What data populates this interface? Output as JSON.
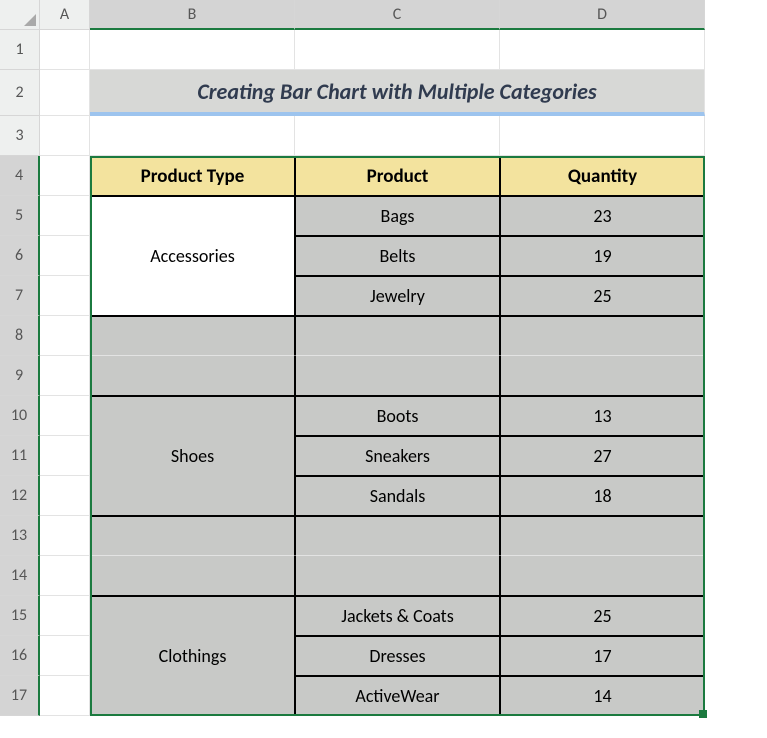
{
  "columns": [
    "A",
    "B",
    "C",
    "D"
  ],
  "rows": [
    "1",
    "2",
    "3",
    "4",
    "5",
    "6",
    "7",
    "8",
    "9",
    "10",
    "11",
    "12",
    "13",
    "14",
    "15",
    "16",
    "17"
  ],
  "title": "Creating Bar Chart with Multiple Categories",
  "headers": {
    "col_b": "Product Type",
    "col_c": "Product",
    "col_d": "Quantity"
  },
  "groups": [
    {
      "type": "Accessories",
      "items": [
        {
          "product": "Bags",
          "qty": "23"
        },
        {
          "product": "Belts",
          "qty": "19"
        },
        {
          "product": "Jewelry",
          "qty": "25"
        }
      ]
    },
    {
      "type": "Shoes",
      "items": [
        {
          "product": "Boots",
          "qty": "13"
        },
        {
          "product": "Sneakers",
          "qty": "27"
        },
        {
          "product": "Sandals",
          "qty": "18"
        }
      ]
    },
    {
      "type": "Clothings",
      "items": [
        {
          "product": "Jackets & Coats",
          "qty": "25"
        },
        {
          "product": "Dresses",
          "qty": "17"
        },
        {
          "product": "ActiveWear",
          "qty": "14"
        }
      ]
    }
  ],
  "chart_data": {
    "type": "table",
    "title": "Creating Bar Chart with Multiple Categories",
    "columns": [
      "Product Type",
      "Product",
      "Quantity"
    ],
    "rows": [
      [
        "Accessories",
        "Bags",
        23
      ],
      [
        "Accessories",
        "Belts",
        19
      ],
      [
        "Accessories",
        "Jewelry",
        25
      ],
      [
        "Shoes",
        "Boots",
        13
      ],
      [
        "Shoes",
        "Sneakers",
        27
      ],
      [
        "Shoes",
        "Sandals",
        18
      ],
      [
        "Clothings",
        "Jackets & Coats",
        25
      ],
      [
        "Clothings",
        "Dresses",
        17
      ],
      [
        "Clothings",
        "ActiveWear",
        14
      ]
    ]
  }
}
